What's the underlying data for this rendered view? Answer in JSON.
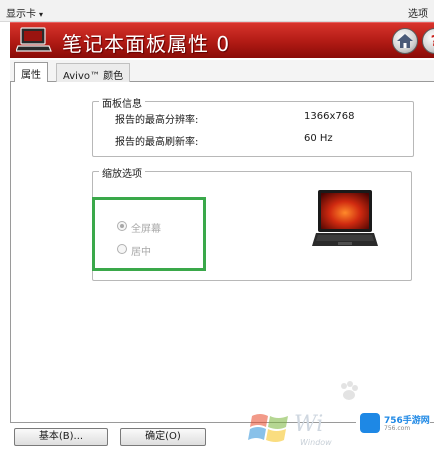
{
  "menubar": {
    "left_label": "显示卡",
    "left_caret": "▾",
    "right_label": "选项"
  },
  "banner": {
    "title": "笔记本面板属性 0",
    "help_glyph": "?",
    "logo_icon": "laptop-icon",
    "home_icon": "home-icon",
    "help_icon": "help-icon",
    "accent_color": "#c0201a"
  },
  "tabs": [
    {
      "label": "属性"
    },
    {
      "label": "Avivo™ 颜色"
    }
  ],
  "panel_info": {
    "legend": "面板信息",
    "rows": [
      {
        "label": "报告的最高分辨率:",
        "value": "1366x768"
      },
      {
        "label": "报告的最高刷新率:",
        "value": "60 Hz"
      }
    ]
  },
  "scaling": {
    "legend": "缩放选项",
    "options": [
      {
        "label": "全屏幕",
        "selected": true
      },
      {
        "label": "居中",
        "selected": false
      }
    ],
    "highlight_color": "#3aa84a"
  },
  "buttons": {
    "basic_label": "基本(B)...",
    "ok_label": "确定(O)"
  },
  "watermark": {
    "windows_text": "Wi",
    "windows_sub": "Window",
    "badge_title": "756手游网",
    "badge_sub": "756.com"
  }
}
